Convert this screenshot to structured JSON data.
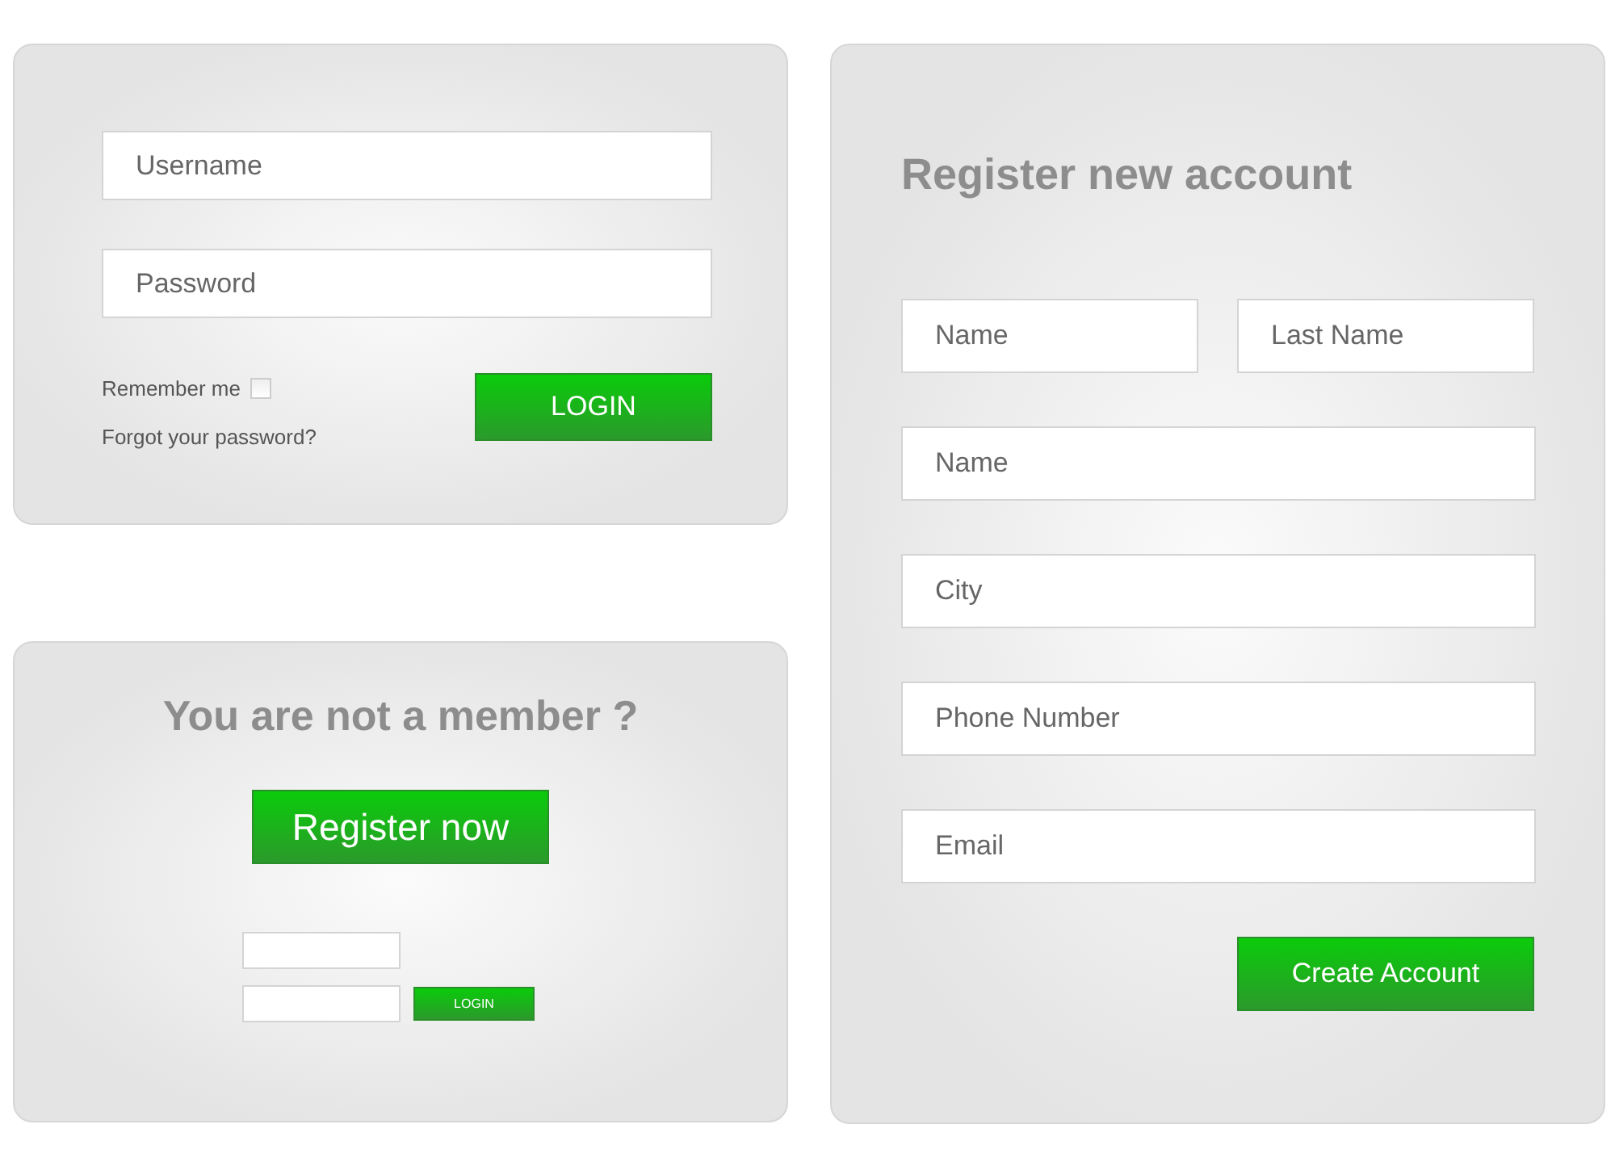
{
  "login": {
    "fields": [
      {
        "placeholder": "Username"
      },
      {
        "placeholder": "Password"
      }
    ],
    "remember": {
      "label": "Remember me",
      "checked": false
    },
    "forgot": "Forgot your password?",
    "button": "LOGIN"
  },
  "member": {
    "title": "You are not a member ?",
    "button": "Register now",
    "mini_button": "LOGIN"
  },
  "register": {
    "title": "Register new account",
    "name_row": [
      {
        "placeholder": "Name"
      },
      {
        "placeholder": "Last Name"
      }
    ],
    "fields": [
      {
        "placeholder": "Name"
      },
      {
        "placeholder": "City"
      },
      {
        "placeholder": "Phone Number"
      },
      {
        "placeholder": "Email"
      }
    ],
    "button": "Create Account"
  }
}
